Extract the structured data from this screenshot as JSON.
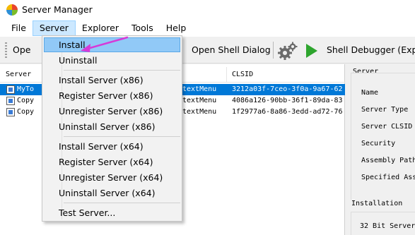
{
  "window": {
    "title": "Server Manager",
    "icon": "app-icon"
  },
  "menubar": {
    "items": [
      "File",
      "Server",
      "Explorer",
      "Tools",
      "Help"
    ],
    "active": "Server"
  },
  "toolbar": {
    "open_label": "Ope",
    "open_shell_dialog_label": "Open Shell Dialog",
    "shell_debugger_label": "Shell Debugger (Expe",
    "icons": [
      "gears-icon",
      "play-icon"
    ],
    "play_color": "#2ea52e"
  },
  "server_list": {
    "columns": [
      "Server",
      "CLSID"
    ],
    "rows": [
      {
        "name": "MyTo",
        "type": "textMenu",
        "clsid": "3212a03f-7ceo-3f0a-9a67-62",
        "selected": true
      },
      {
        "name": "Copy",
        "type": "textMenu",
        "clsid": "4086a126-90bb-36f1-89da-83",
        "selected": false
      },
      {
        "name": "Copy",
        "type": "textMenu",
        "clsid": "1f2977a6-8a86-3edd-ad72-76",
        "selected": false
      }
    ]
  },
  "right_pane": {
    "group_title": "Server",
    "fields": [
      "Name",
      "Server Type",
      "Server CLSID",
      "Security",
      "Assembly Path",
      "Specified Asse"
    ],
    "installation_title": "Installation",
    "installation_fields": [
      "32 Bit Server"
    ]
  },
  "server_menu": {
    "groups": [
      [
        "Install",
        "Uninstall"
      ],
      [
        "Install Server (x86)",
        "Register Server (x86)",
        "Unregister Server (x86)",
        "Uninstall Server (x86)"
      ],
      [
        "Install Server (x64)",
        "Register Server (x64)",
        "Unregister Server (x64)",
        "Uninstall Server (x64)"
      ],
      [
        "Test Server..."
      ]
    ],
    "highlighted": "Install"
  },
  "annotation": {
    "arrow_color": "#d63ad8"
  },
  "colors": {
    "selection": "#0078d7",
    "menu_hover": "#91c9f7"
  }
}
